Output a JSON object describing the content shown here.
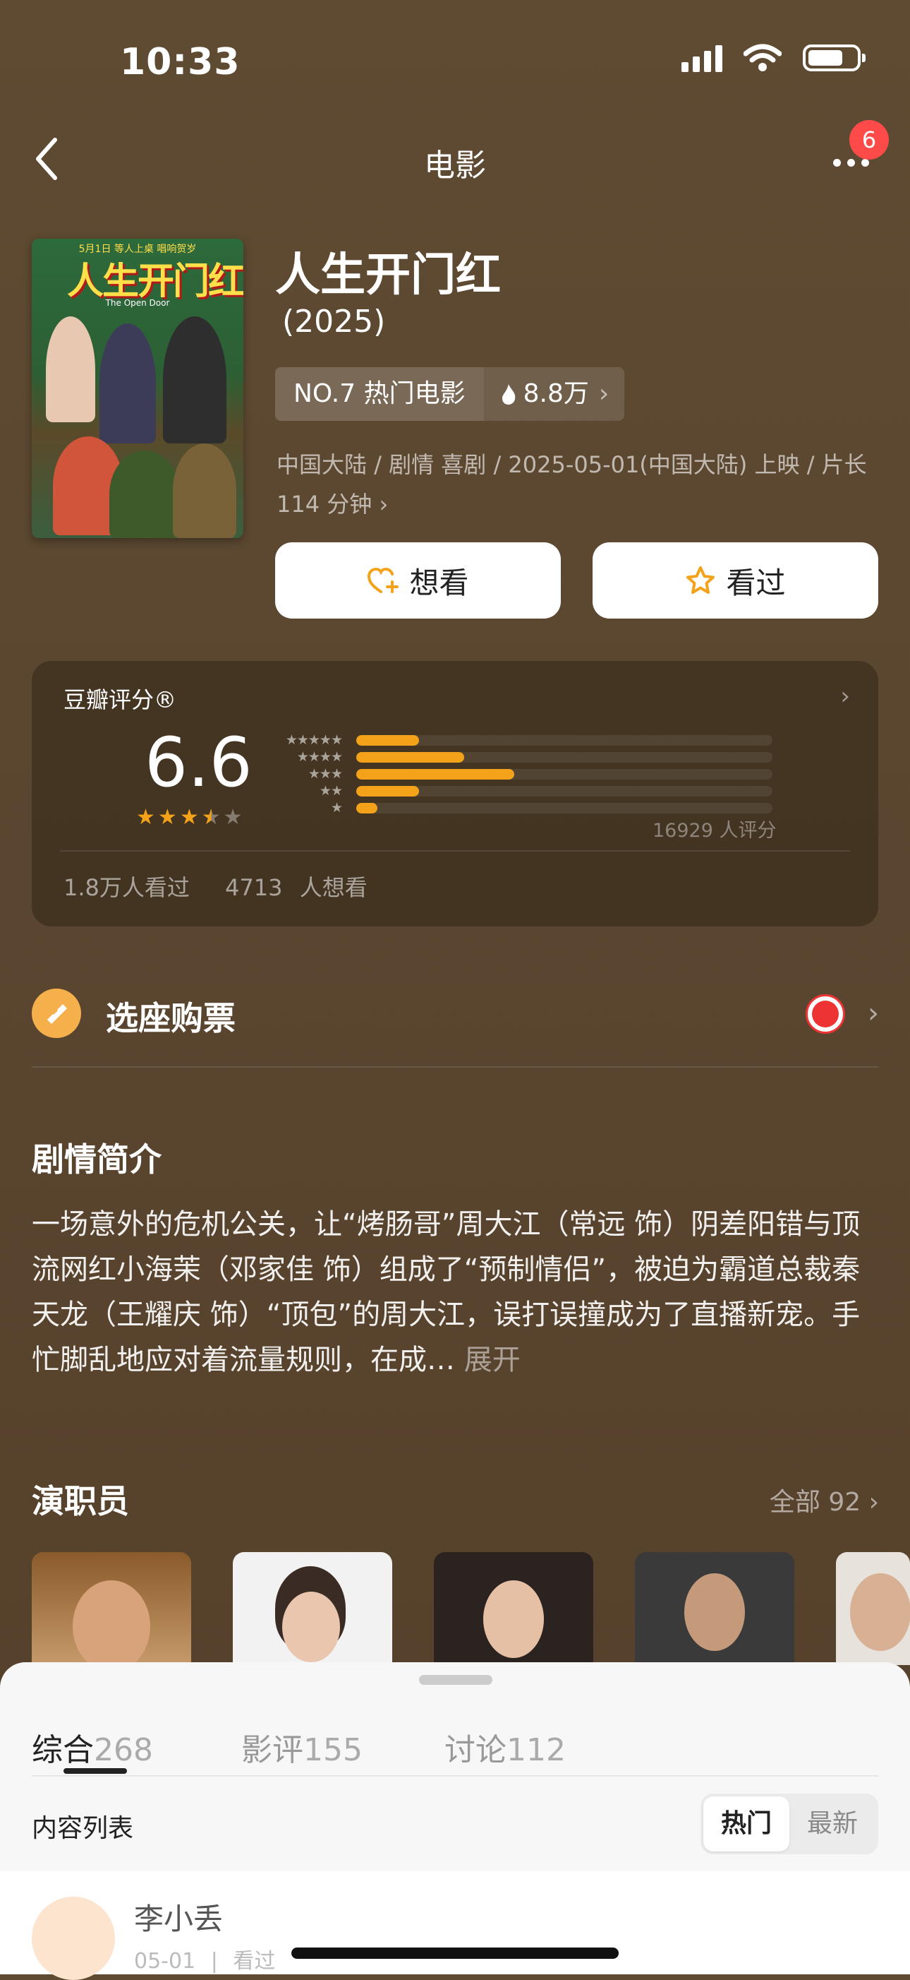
{
  "status_bar": {
    "time": "10:33"
  },
  "nav": {
    "title": "电影",
    "badge": "6"
  },
  "movie": {
    "title": "人生开门红",
    "year": "(2025)",
    "rank": "NO.7 热门电影",
    "heat": "8.8万",
    "meta": "中国大陆 / 剧情 喜剧 / 2025-05-01(中国大陆) 上映 / 片长 114 分钟",
    "poster": {
      "top_text": "5月1日 等人上桌 唱响贺岁",
      "title": "人生开门红",
      "subtitle": "The Open Door"
    }
  },
  "actions": {
    "want": "想看",
    "seen": "看过"
  },
  "rating": {
    "label": "豆瓣评分®",
    "score": "6.6",
    "stars_value": 3.5,
    "distribution_percent": [
      15,
      26,
      38,
      15,
      5
    ],
    "count": "16929 人评分",
    "watched": "1.8万人看过",
    "wanted": "4713 人想看"
  },
  "ticket": {
    "label": "选座购票"
  },
  "synopsis": {
    "heading": "剧情简介",
    "text": "一场意外的危机公关，让“烤肠哥”周大江（常远 饰）阴差阳错与顶流网红小海茉（邓家佳 饰）组成了“预制情侣”，被迫为霸道总裁秦天龙（王耀庆 饰）“顶包”的周大江，误打误撞成为了直播新宠。手忙脚乱地应对着流量规则，在成…",
    "more": "展开"
  },
  "cast": {
    "heading": "演职员",
    "all": "全部 92"
  },
  "sheet": {
    "tabs": [
      {
        "label": "综合",
        "count": "268"
      },
      {
        "label": "影评",
        "count": "155"
      },
      {
        "label": "讨论",
        "count": "112"
      }
    ],
    "list_title": "内容列表",
    "sort": [
      "热门",
      "最新"
    ],
    "first_item": {
      "user": "李小丢",
      "date": "05-01",
      "status": "看过"
    }
  },
  "colors": {
    "accent": "#f5a21b",
    "badge": "#ff4a4a",
    "background": "#5a4630"
  }
}
